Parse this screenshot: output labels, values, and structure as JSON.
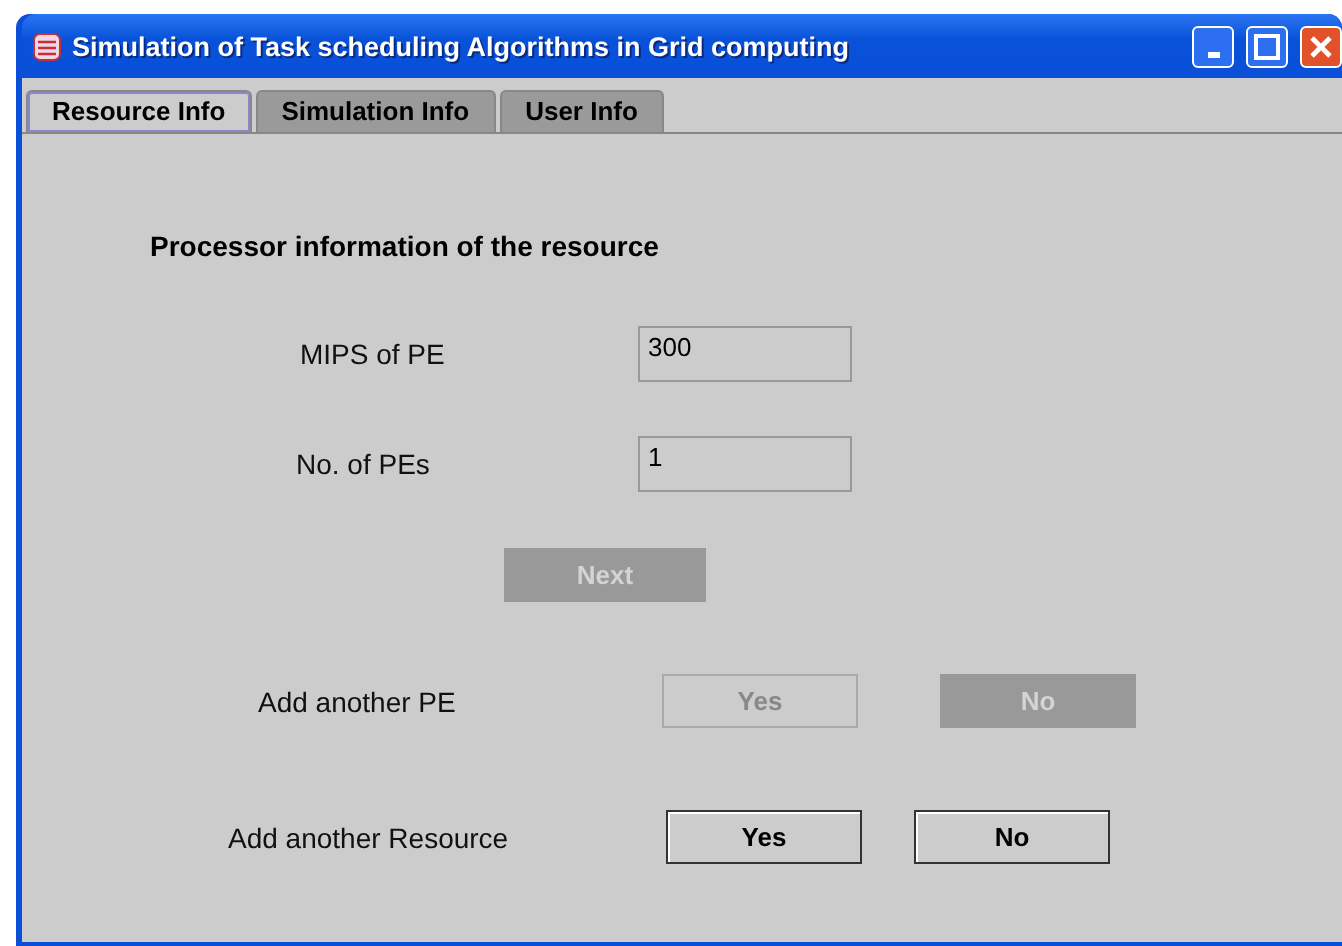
{
  "window": {
    "title": "Simulation of Task scheduling Algorithms in Grid computing"
  },
  "tabs": [
    {
      "label": "Resource Info",
      "selected": true
    },
    {
      "label": "Simulation Info",
      "selected": false
    },
    {
      "label": "User Info",
      "selected": false
    }
  ],
  "heading": "Processor information of the resource",
  "fields": [
    {
      "label": "MIPS of PE",
      "value": "300"
    },
    {
      "label": "No. of PEs",
      "value": "1"
    }
  ],
  "next_button": {
    "label": "Next",
    "disabled": true
  },
  "add_pe": {
    "label": "Add another PE",
    "buttons": [
      {
        "label": "Yes",
        "kind": "outline",
        "disabled": true
      },
      {
        "label": "No",
        "kind": "filled",
        "disabled": true
      }
    ]
  },
  "add_resource": {
    "label": "Add another Resource",
    "buttons": [
      {
        "label": "Yes",
        "kind": "outline",
        "disabled": false
      },
      {
        "label": "No",
        "kind": "outline",
        "disabled": false
      }
    ]
  }
}
